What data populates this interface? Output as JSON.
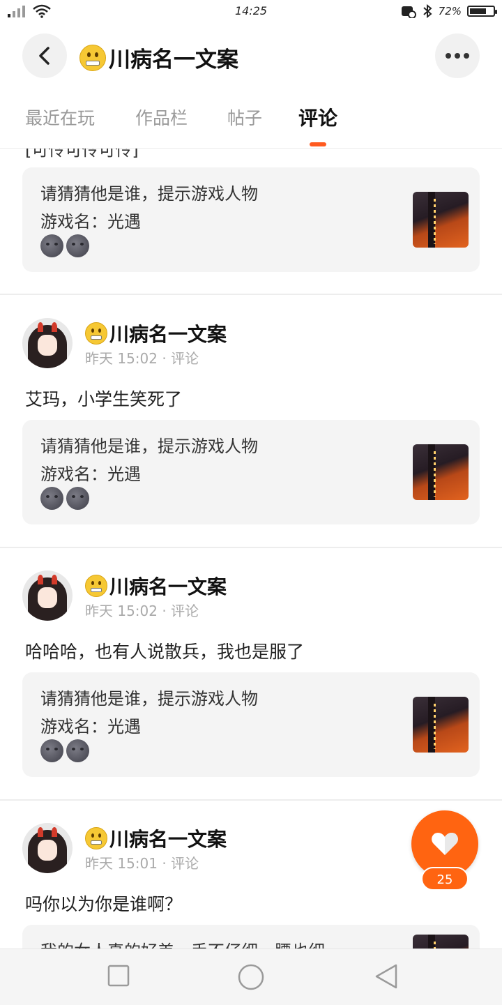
{
  "status_bar": {
    "time": "14:25",
    "battery": "72%",
    "battery_level": 0.72
  },
  "header": {
    "title": "川病名一文案",
    "emoji": "zipper-mouth-face"
  },
  "tabs": [
    {
      "label": "最近在玩",
      "active": false
    },
    {
      "label": "作品栏",
      "active": false
    },
    {
      "label": "帖子",
      "active": false
    },
    {
      "label": "评论",
      "active": true
    }
  ],
  "feed": {
    "cut_text": "[可怜可怜可怜]",
    "quote": {
      "line1": "请猜猜他是谁，提示游戏人物",
      "line2": "游戏名：光遇"
    },
    "posts": [
      {
        "author": "川病名一文案",
        "meta": "昨天 15:02 · 评论",
        "text": "艾玛，小学生笑死了"
      },
      {
        "author": "川病名一文案",
        "meta": "昨天 15:02 · 评论",
        "text": "哈哈哈，也有人说散兵，我也是服了"
      },
      {
        "author": "川病名一文案",
        "meta": "昨天 15:01 · 评论",
        "text": "吗你以为你是谁啊？",
        "quote_partial": "我的女人真的好美，手不仔细，腰也细"
      }
    ]
  },
  "like": {
    "count": "25"
  },
  "colors": {
    "accent": "#ff6411",
    "card_bg": "#f4f4f4"
  }
}
